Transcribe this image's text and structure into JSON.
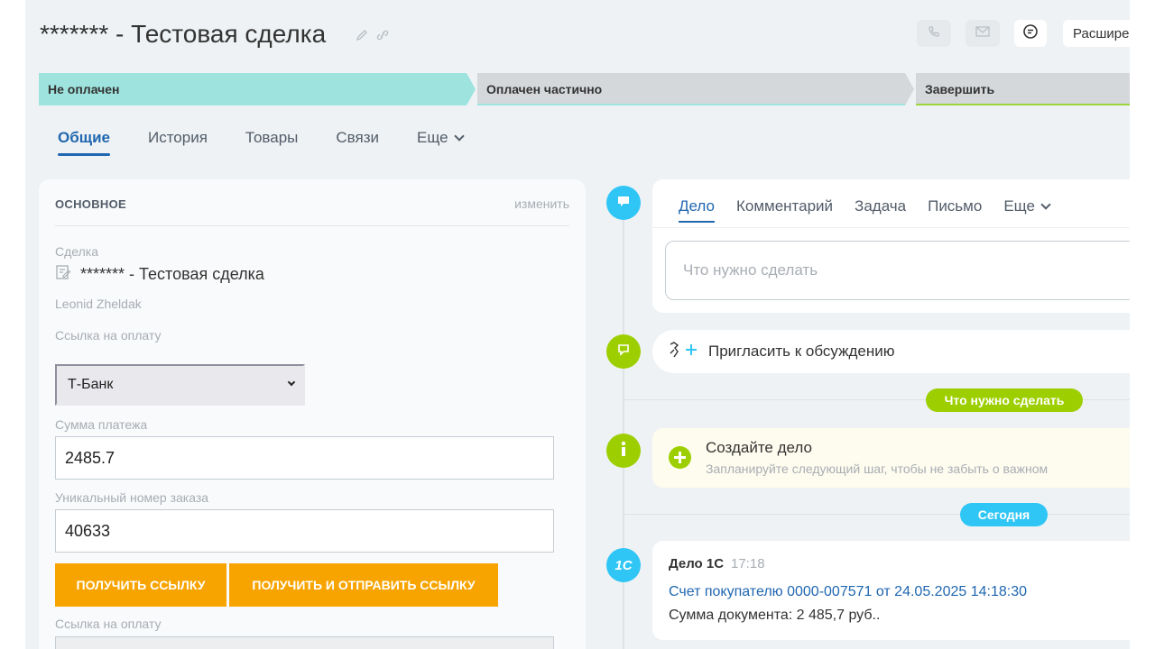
{
  "header": {
    "title": "******* - Тестовая сделка",
    "expand_label": "Расширения"
  },
  "stages": [
    {
      "label": "Не оплачен",
      "color": "#9ee3dd"
    },
    {
      "label": "Оплачен частично",
      "color": "#d5d8db"
    },
    {
      "label": "Завершить",
      "color": "#d5d8db"
    }
  ],
  "tabs": [
    {
      "label": "Общие"
    },
    {
      "label": "История"
    },
    {
      "label": "Товары"
    },
    {
      "label": "Связи"
    },
    {
      "label": "Еще"
    }
  ],
  "main": {
    "section_title": "ОСНОВНОЕ",
    "edit_label": "изменить",
    "deal_label": "Сделка",
    "deal_name": "******* - Тестовая сделка",
    "responsible": "Leonid Zheldak",
    "payment_link_label": "Ссылка на оплату",
    "bank_selected": "Т-Банк",
    "amount_label": "Сумма платежа",
    "amount_value": "2485.7",
    "order_label": "Уникальный номер заказа",
    "order_value": "40633",
    "get_link_btn": "ПОЛУЧИТЬ ССЫЛКУ",
    "get_send_link_btn": "ПОЛУЧИТЬ И ОТПРАВИТЬ ССЫЛКУ",
    "payment_link_label2": "Ссылка на оплату"
  },
  "timeline": {
    "editor_tabs": [
      {
        "label": "Дело"
      },
      {
        "label": "Комментарий"
      },
      {
        "label": "Задача"
      },
      {
        "label": "Письмо"
      },
      {
        "label": "Еще"
      }
    ],
    "editor_placeholder": "Что нужно сделать",
    "invite_label": "Пригласить к обсуждению",
    "todo_pill": "Что нужно сделать",
    "todo_title": "Создайте дело",
    "todo_sub": "Запланируйте следующий шаг, чтобы не забыть о важном",
    "today_pill": "Сегодня",
    "c1_badge": "1С",
    "c1_title": "Дело 1С",
    "c1_time": "17:18",
    "c1_link": "Счет покупателю 0000-007571 от 24.05.2025 14:18:30",
    "c1_sum": "Сумма документа: 2 485,7 руб.."
  }
}
